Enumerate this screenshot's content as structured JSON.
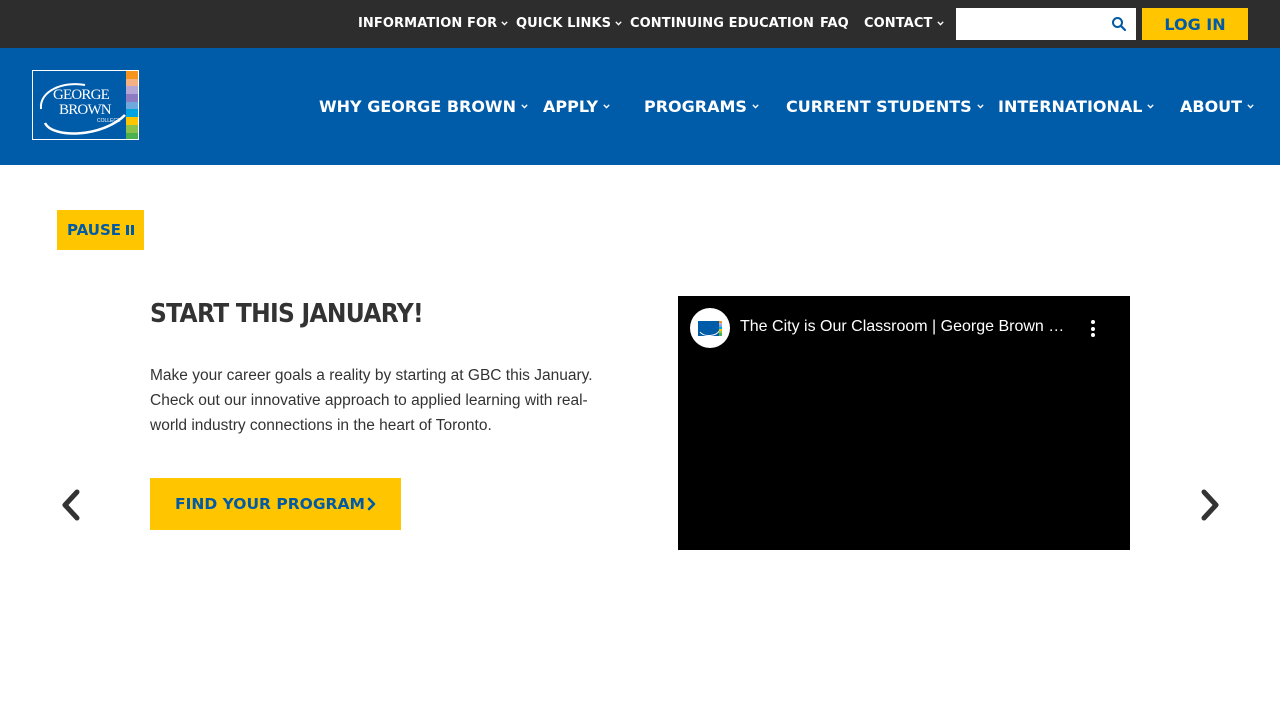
{
  "topbar": {
    "items": [
      {
        "label": "INFORMATION FOR",
        "has_dropdown": true
      },
      {
        "label": "QUICK LINKS",
        "has_dropdown": true
      },
      {
        "label": "CONTINUING EDUCATION",
        "has_dropdown": false
      },
      {
        "label": "FAQ",
        "has_dropdown": false
      },
      {
        "label": "CONTACT",
        "has_dropdown": true
      }
    ],
    "search_value": "",
    "search_icon": "search-icon",
    "login_label": "LOG IN"
  },
  "logo": {
    "line1": "GEORGE",
    "line2": "BROWN",
    "line3": "COLLEGE",
    "stripe_colors": [
      "#f7941d",
      "#f4b183",
      "#b4a7d6",
      "#8e7cc3",
      "#6fa8dc",
      "#00a3e0",
      "#ffc600",
      "#8bc34a",
      "#4caf50"
    ]
  },
  "mainnav": {
    "items": [
      {
        "label": "WHY GEORGE BROWN"
      },
      {
        "label": "APPLY"
      },
      {
        "label": "PROGRAMS"
      },
      {
        "label": "CURRENT STUDENTS"
      },
      {
        "label": "INTERNATIONAL"
      },
      {
        "label": "ABOUT"
      }
    ]
  },
  "carousel": {
    "pause_label": "PAUSE",
    "slide": {
      "title": "START THIS JANUARY!",
      "description": "Make your career goals a reality by starting at GBC this January. Check out our innovative approach to applied learning with real-world industry connections in the heart of Toronto.",
      "cta_label": "FIND YOUR PROGRAM"
    },
    "video": {
      "title": "The City is Our Classroom | George Brown College"
    }
  },
  "colors": {
    "topbar_bg": "#2d2d2d",
    "nav_bg": "#005ba9",
    "accent_yellow": "#ffc600",
    "accent_blue": "#005aa6",
    "text_dark": "#333333"
  }
}
